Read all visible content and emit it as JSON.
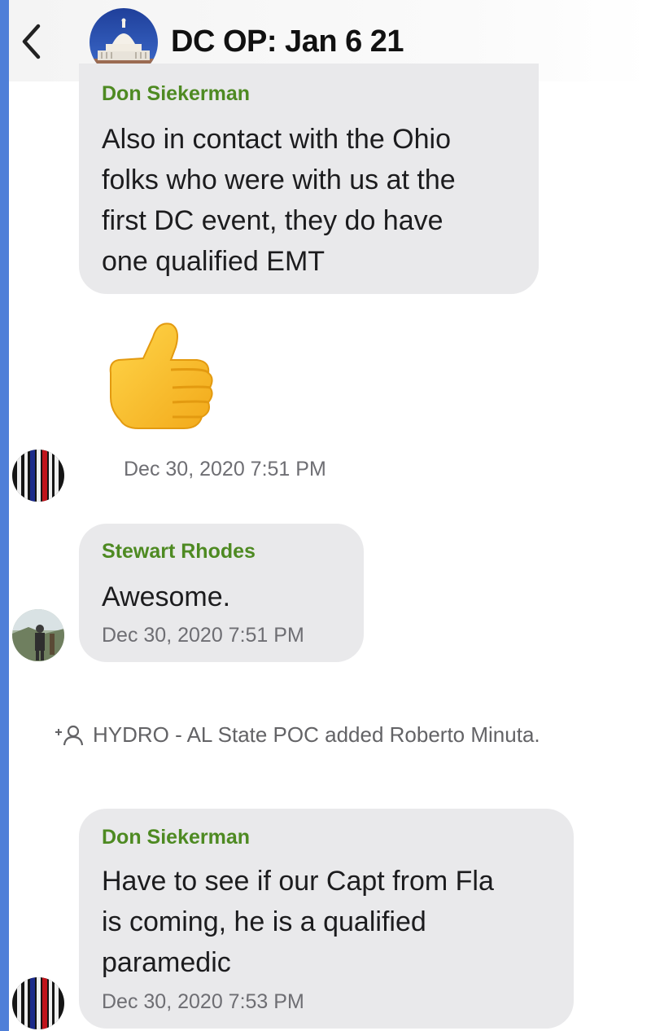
{
  "header": {
    "title": "DC OP: Jan 6 21",
    "back_icon": "chevron-left-icon",
    "avatar_icon": "capitol-building-icon"
  },
  "messages": [
    {
      "sender": "Don Siekerman",
      "lines": [
        "Also in contact with the Ohio",
        "folks who were with us at the",
        "first DC event, they do have",
        "one qualified EMT"
      ]
    },
    {
      "emoji_icon": "thumbs-up-icon",
      "timestamp": "Dec 30, 2020 7:51 PM"
    },
    {
      "sender": "Stewart Rhodes",
      "lines": [
        "Awesome."
      ],
      "timestamp": "Dec 30, 2020 7:51 PM"
    },
    {
      "sender": "Don Siekerman",
      "lines": [
        "Have to see if our Capt from Fla",
        "is coming, he is a qualified",
        "paramedic"
      ],
      "timestamp": "Dec 30, 2020 7:53 PM"
    }
  ],
  "system_event": {
    "text": "HYDRO - AL State POC added Roberto Minuta.",
    "icon": "add-person-icon"
  },
  "colors": {
    "sender_name": "#4e8a22",
    "bubble": "#e9e9eb",
    "left_strip": "#4f7fd8"
  }
}
